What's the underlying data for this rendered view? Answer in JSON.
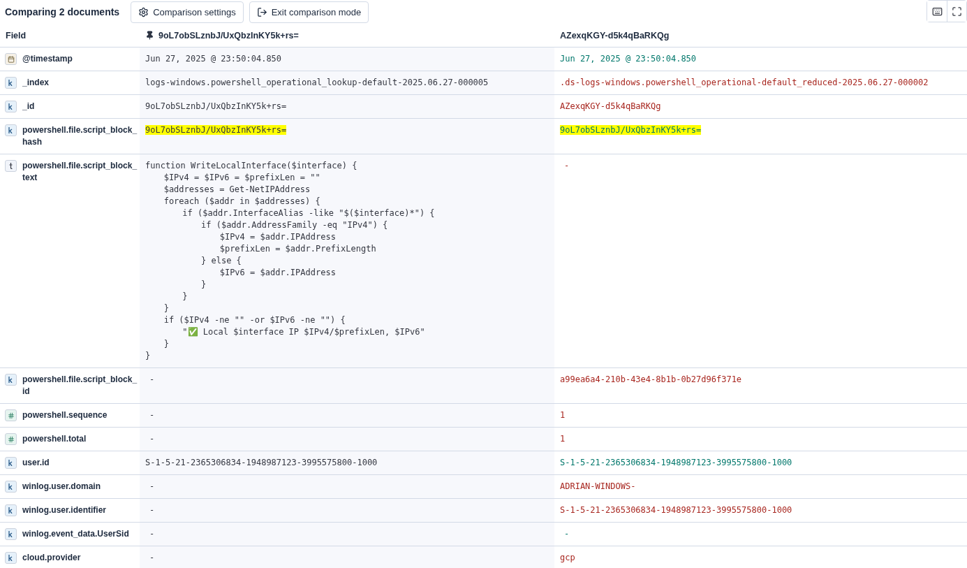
{
  "toolbar": {
    "title": "Comparing 2 documents",
    "buttons": [
      {
        "kind": "settings",
        "label": "Comparison settings"
      },
      {
        "kind": "exit",
        "label": "Exit comparison mode"
      }
    ],
    "icon_buttons": [
      {
        "kind": "keyboard"
      },
      {
        "kind": "fullscreen"
      }
    ]
  },
  "table": {
    "columns": [
      {
        "label": "Field",
        "pinned": false
      },
      {
        "label": "9oL7obSLznbJ/UxQbzInKY5k+rs=",
        "pinned": true
      },
      {
        "label": "AZexqKGY-d5k4qBaRKQg",
        "pinned": false
      }
    ],
    "rows": [
      {
        "kind": "date",
        "field": "@timestamp",
        "base": "Jun 27, 2025 @ 23:50:04.850",
        "compare": "Jun 27, 2025 @ 23:50:04.850",
        "matches": true,
        "highlight": false
      },
      {
        "kind": "keyword",
        "field": "_index",
        "base": "logs-windows.powershell_operational_lookup-default-2025.06.27-000005",
        "compare": ".ds-logs-windows.powershell_operational-default_reduced-2025.06.27-000002",
        "matches": false,
        "highlight": false
      },
      {
        "kind": "keyword",
        "field": "_id",
        "base": "9oL7obSLznbJ/UxQbzInKY5k+rs=",
        "compare": "AZexqKGY-d5k4qBaRKQg",
        "matches": false,
        "highlight": false
      },
      {
        "kind": "keyword",
        "field": "powershell.file.script_block_hash",
        "base": "9oL7obSLznbJ/UxQbzInKY5k+rs=",
        "compare": "9oL7obSLznbJ/UxQbzInKY5k+rs=",
        "matches": true,
        "highlight": true
      },
      {
        "kind": "text",
        "field": "powershell.file.script_block_text",
        "base": "function WriteLocalInterface($interface) {\n\t$IPv4 = $IPv6 = $prefixLen = \"\"\n\t$addresses = Get-NetIPAddress\n\tforeach ($addr in $addresses) {\n\t\tif ($addr.InterfaceAlias -like \"$($interface)*\") {\n\t\t\tif ($addr.AddressFamily -eq \"IPv4\") {\n\t\t\t\t$IPv4 = $addr.IPAddress\n\t\t\t\t$prefixLen = $addr.PrefixLength\n\t\t\t} else {\n\t\t\t\t$IPv6 = $addr.IPAddress\n\t\t\t}\n\t\t}\n\t}\n\tif ($IPv4 -ne \"\" -or $IPv6 -ne \"\") {\n\t\t\"✅ Local $interface IP $IPv4/$prefixLen, $IPv6\"\n\t}\n}",
        "compare": "-",
        "matches": false,
        "highlight": false
      },
      {
        "kind": "keyword",
        "field": "powershell.file.script_block_id",
        "base": "-",
        "compare": "a99ea6a4-210b-43e4-8b1b-0b27d96f371e",
        "matches": false,
        "highlight": false
      },
      {
        "kind": "number",
        "field": "powershell.sequence",
        "base": "-",
        "compare": "1",
        "matches": false,
        "highlight": false
      },
      {
        "kind": "number",
        "field": "powershell.total",
        "base": "-",
        "compare": "1",
        "matches": false,
        "highlight": false
      },
      {
        "kind": "keyword",
        "field": "user.id",
        "base": "S-1-5-21-2365306834-1948987123-3995575800-1000",
        "compare": "S-1-5-21-2365306834-1948987123-3995575800-1000",
        "matches": true,
        "highlight": false
      },
      {
        "kind": "keyword",
        "field": "winlog.user.domain",
        "base": "-",
        "compare": "ADRIAN-WINDOWS-",
        "matches": false,
        "highlight": false
      },
      {
        "kind": "keyword",
        "field": "winlog.user.identifier",
        "base": "-",
        "compare": "S-1-5-21-2365306834-1948987123-3995575800-1000",
        "matches": false,
        "highlight": false
      },
      {
        "kind": "keyword",
        "field": "winlog.event_data.UserSid",
        "base": "-",
        "compare": "-",
        "matches": true,
        "highlight": false
      },
      {
        "kind": "keyword",
        "field": "cloud.provider",
        "base": "-",
        "compare": "gcp",
        "matches": false,
        "highlight": false
      }
    ]
  }
}
